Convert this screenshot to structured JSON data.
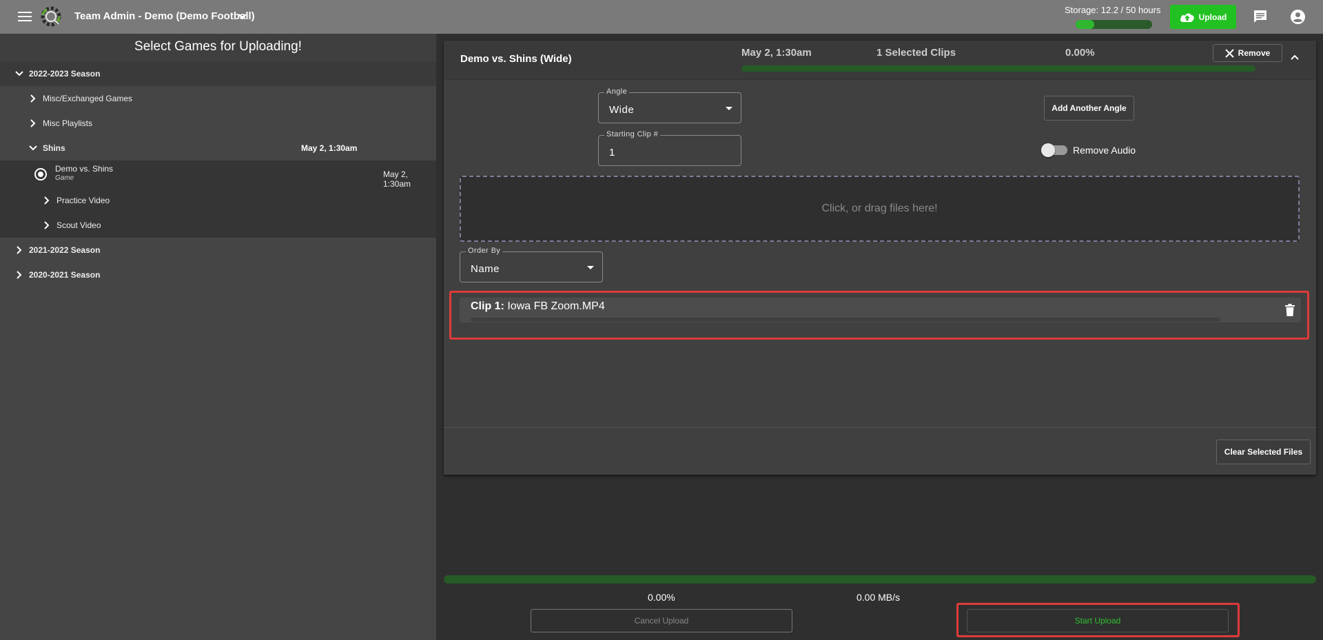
{
  "header": {
    "team_title": "Team Admin - Demo (Demo Football)",
    "storage_label": "Storage: 12.2 / 50 hours",
    "storage_fraction": 0.244,
    "upload_label": "Upload",
    "accent_color": "#22c122"
  },
  "left": {
    "title": "Select Games for Uploading!",
    "season_2223": "2022-2023 Season",
    "misc_exchanged": "Misc/Exchanged Games",
    "misc_playlists": "Misc Playlists",
    "shins": "Shins",
    "shins_date": "May 2, 1:30am",
    "game_name": "Demo vs. Shins",
    "game_type": "Game",
    "game_date": "May 2, 1:30am",
    "practice_video": "Practice Video",
    "scout_video": "Scout Video",
    "season_2122": "2021-2022 Season",
    "season_2021": "2020-2021 Season"
  },
  "card": {
    "title": "Demo vs. Shins (Wide)",
    "date": "May 2, 1:30am",
    "selected_clips": "1 Selected Clips",
    "percent": "0.00%",
    "remove_label": "Remove",
    "angle_label": "Angle",
    "angle_value": "Wide",
    "add_angle_label": "Add Another Angle",
    "starting_clip_label": "Starting Clip #",
    "starting_clip_value": "1",
    "remove_audio_label": "Remove Audio",
    "dropzone_text": "Click, or drag files here!",
    "order_by_label": "Order By",
    "order_by_value": "Name",
    "clip_prefix": "Clip 1:",
    "clip_name": "Iowa FB Zoom.MP4",
    "clear_label": "Clear Selected Files"
  },
  "footer": {
    "total_percent": "0.00%",
    "speed": "0.00 MB/s",
    "cancel_label": "Cancel Upload",
    "start_label": "Start Upload"
  }
}
